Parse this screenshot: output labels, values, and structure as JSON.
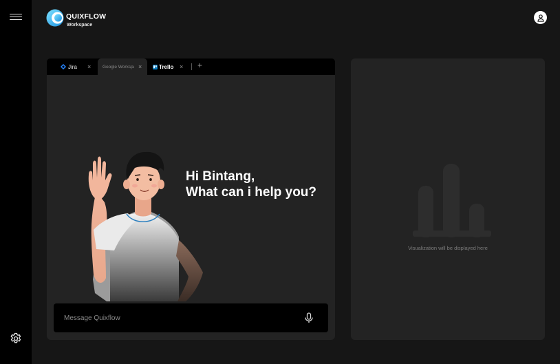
{
  "brand": {
    "name": "QUIXFLOW",
    "subtitle": "Workspace"
  },
  "tabs": [
    {
      "label": "Jira",
      "close": "×"
    },
    {
      "label": "Google Workspace",
      "close": "×"
    },
    {
      "label": "Trello",
      "close": "×"
    }
  ],
  "tab_add": "+",
  "greeting": {
    "line1": "Hi Bintang,",
    "line2": "What can i help you?"
  },
  "message": {
    "placeholder": "Message Quixflow",
    "value": ""
  },
  "visualization": {
    "caption": "Visualization will be displayed here"
  },
  "icons": {
    "menu": "menu-icon",
    "settings": "gear-icon",
    "profile": "user-icon",
    "mic": "microphone-icon",
    "logo": "quixflow-logo",
    "placeholder": "bar-chart-icon"
  },
  "colors": {
    "background": "#161616",
    "rail": "#000000",
    "panel": "#232323",
    "tabbar": "#000000",
    "text": "#ffffff",
    "muted": "#8a8a8a",
    "logo_accent": "#2fb8ff"
  }
}
